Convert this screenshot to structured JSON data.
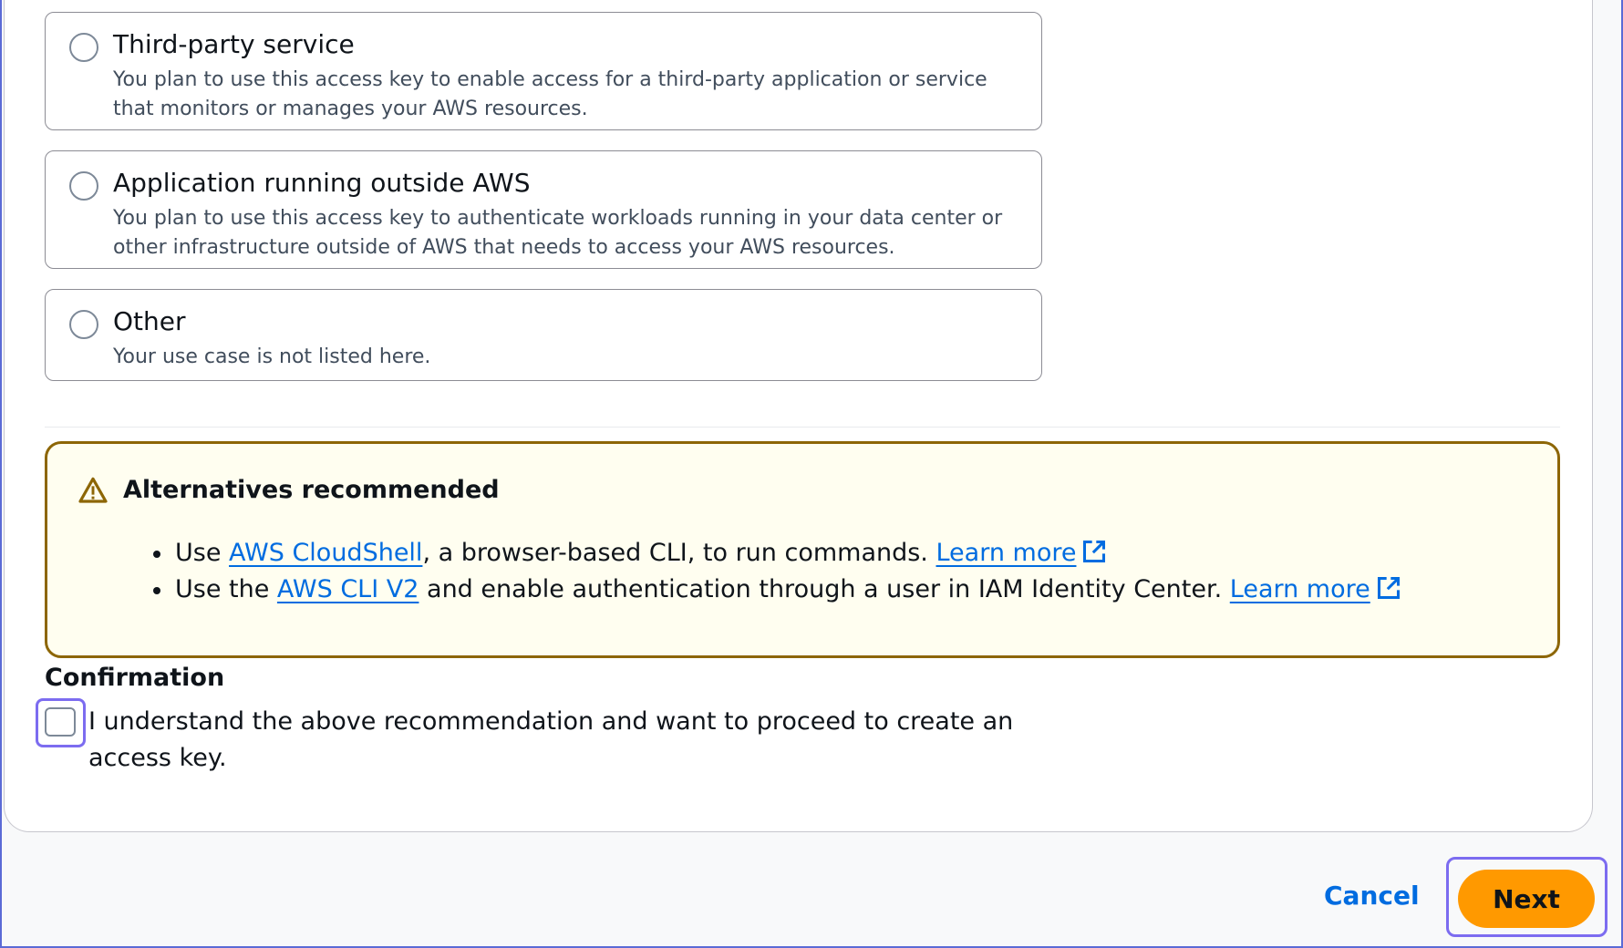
{
  "options": [
    {
      "title": "Third-party service",
      "description": "You plan to use this access key to enable access for a third-party application or service that monitors or manages your AWS resources."
    },
    {
      "title": "Application running outside AWS",
      "description": "You plan to use this access key to authenticate workloads running in your data center or other infrastructure outside of AWS that needs to access your AWS resources."
    },
    {
      "title": "Other",
      "description": "Your use case is not listed here."
    }
  ],
  "alert": {
    "title": "Alternatives recommended",
    "items": [
      {
        "prefix": "Use ",
        "link": "AWS CloudShell",
        "middle": ", a browser-based CLI, to run commands. ",
        "learn_more": "Learn more"
      },
      {
        "prefix": "Use the ",
        "link": "AWS CLI V2",
        "middle": " and enable authentication through a user in IAM Identity Center. ",
        "learn_more": "Learn more"
      }
    ]
  },
  "confirmation": {
    "title": "Confirmation",
    "checkbox_label": "I understand the above recommendation and want to proceed to create an access key.",
    "checked": false
  },
  "actions": {
    "cancel_label": "Cancel",
    "next_label": "Next"
  },
  "colors": {
    "primary_button": "#ff9900",
    "link": "#006ce0",
    "warning_border": "#8d6605",
    "warning_bg": "#fffef0",
    "focus_ring": "#7c6cf0"
  }
}
